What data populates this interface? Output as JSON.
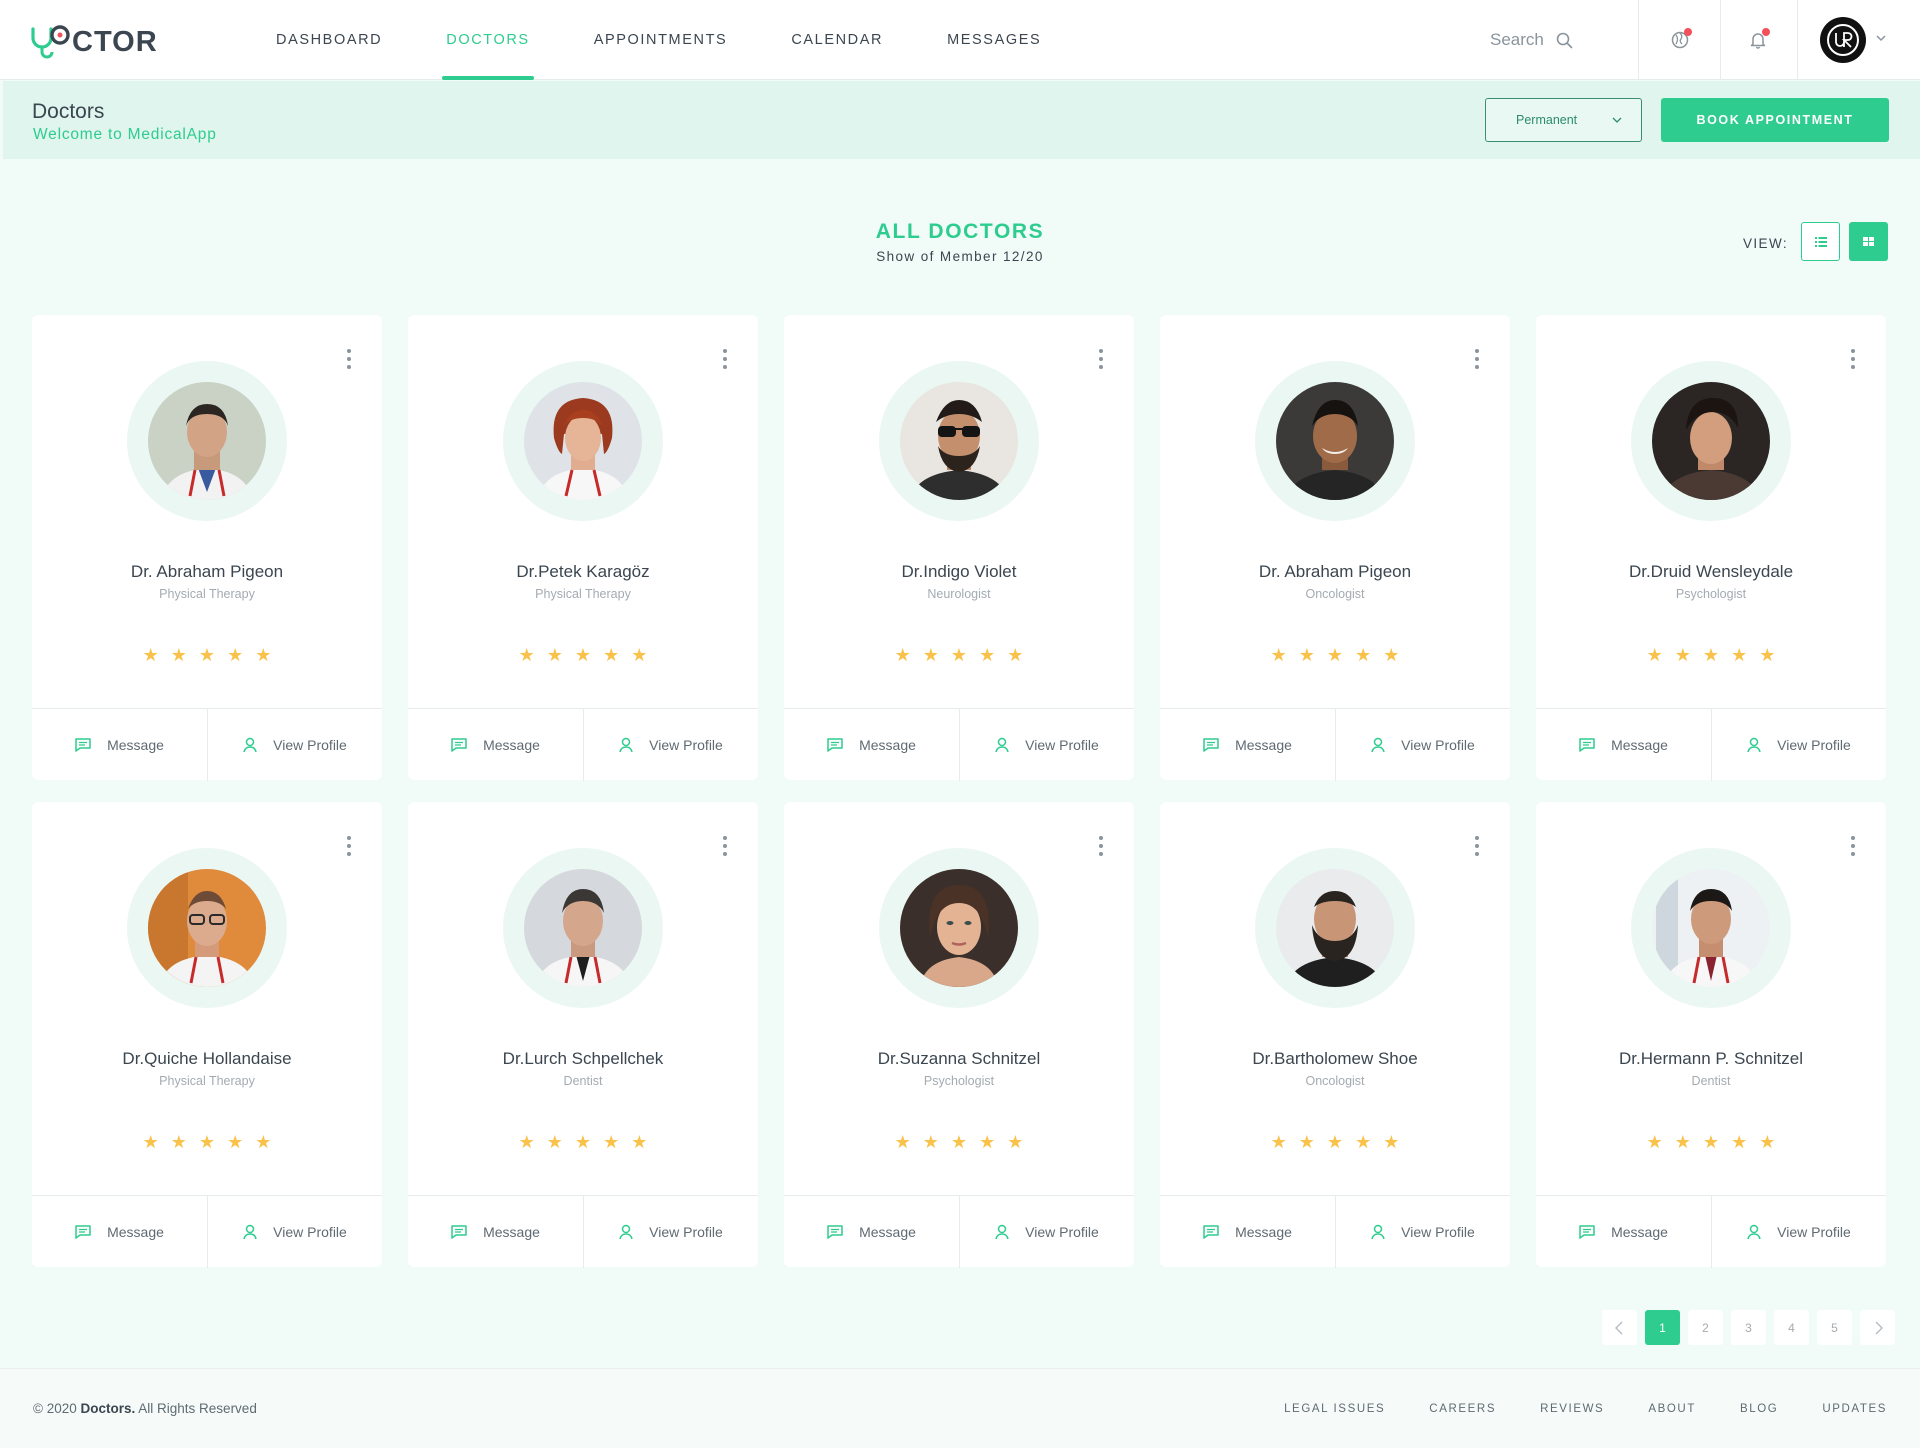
{
  "header": {
    "logo_text": "CTOR",
    "nav": [
      {
        "label": "DASHBOARD"
      },
      {
        "label": "DOCTORS"
      },
      {
        "label": "APPOINTMENTS"
      },
      {
        "label": "CALENDAR"
      },
      {
        "label": "MESSAGES"
      }
    ],
    "active_nav": "DOCTORS",
    "search_label": "Search",
    "avatar_initials": "UR"
  },
  "subheader": {
    "title": "Doctors",
    "subtitle": "Welcome to MedicalApp",
    "select_value": "Permanent",
    "book_button": "BOOK APPOINTMENT"
  },
  "section": {
    "title": "ALL DOCTORS",
    "subtitle": "Show of Member 12/20",
    "view_label": "VIEW:"
  },
  "doctors": [
    {
      "name": "Dr. Abraham Pigeon",
      "specialty": "Physical Therapy",
      "rating": 5
    },
    {
      "name": "Dr.Petek Karagöz",
      "specialty": "Physical Therapy",
      "rating": 5
    },
    {
      "name": "Dr.Indigo Violet",
      "specialty": "Neurologist",
      "rating": 5
    },
    {
      "name": "Dr. Abraham Pigeon",
      "specialty": "Oncologist",
      "rating": 5
    },
    {
      "name": "Dr.Druid Wensleydale",
      "specialty": "Psychologist",
      "rating": 5
    },
    {
      "name": "Dr.Quiche Hollandaise",
      "specialty": "Physical Therapy",
      "rating": 5
    },
    {
      "name": "Dr.Lurch Schpellchek",
      "specialty": "Dentist",
      "rating": 5
    },
    {
      "name": "Dr.Suzanna Schnitzel",
      "specialty": "Psychologist",
      "rating": 5
    },
    {
      "name": "Dr.Bartholomew Shoe",
      "specialty": "Oncologist",
      "rating": 5
    },
    {
      "name": "Dr.Hermann P. Schnitzel",
      "specialty": "Dentist",
      "rating": 5
    }
  ],
  "card_actions": {
    "message": "Message",
    "view_profile": "View Profile"
  },
  "pagination": {
    "pages": [
      "1",
      "2",
      "3",
      "4",
      "5"
    ],
    "current": "1"
  },
  "footer": {
    "copyright_prefix": "© 2020",
    "brand": "Doctors.",
    "copyright_suffix": "All Rights Reserved",
    "links": [
      "LEGAL ISSUES",
      "CAREERS",
      "REVIEWS",
      "ABOUT",
      "BLOG",
      "UPDATES"
    ]
  },
  "colors": {
    "accent": "#2ecc8f",
    "star": "#f9c24a",
    "text": "#3b4650",
    "subheader_bg": "#dff5ee"
  }
}
